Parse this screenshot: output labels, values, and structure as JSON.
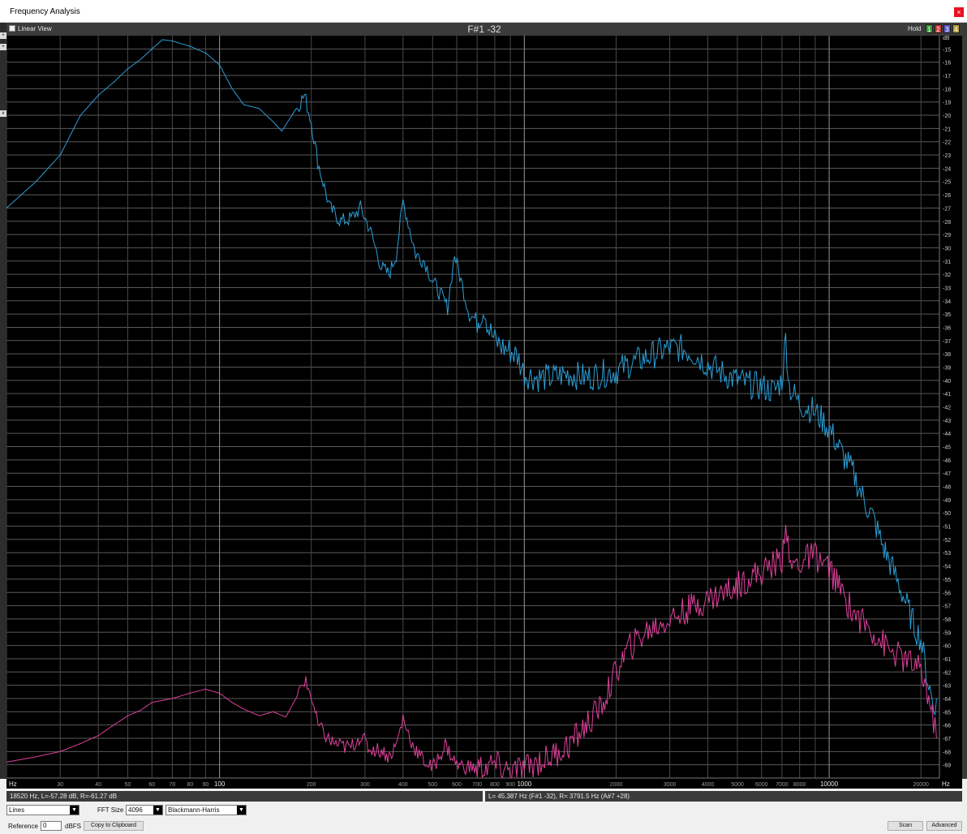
{
  "window": {
    "title": "Frequency Analysis",
    "close_glyph": "×"
  },
  "left_strip": {
    "marks": [
      "+",
      "+",
      "v"
    ]
  },
  "header": {
    "linear_view_label": "Linear View",
    "plot_title": "F#1 -32",
    "hold_label": "Hold",
    "hold_buttons": [
      {
        "label": "1",
        "color": "#3c9c3c"
      },
      {
        "label": "2",
        "color": "#c83c3c"
      },
      {
        "label": "3",
        "color": "#5a5ac8"
      },
      {
        "label": "4",
        "color": "#b4a03c"
      }
    ]
  },
  "chart_data": {
    "type": "line",
    "title": "F#1 -32",
    "x_scale": "log",
    "xlim": [
      20,
      23000
    ],
    "ylim": [
      -70,
      -14
    ],
    "y_unit": "dB",
    "x_unit": "Hz",
    "grid": true,
    "x_tick_labels": [
      {
        "f": 30,
        "label": "30"
      },
      {
        "f": 40,
        "label": "40"
      },
      {
        "f": 50,
        "label": "50"
      },
      {
        "f": 60,
        "label": "60"
      },
      {
        "f": 70,
        "label": "70"
      },
      {
        "f": 80,
        "label": "80"
      },
      {
        "f": 90,
        "label": "90"
      },
      {
        "f": 100,
        "label": "100"
      },
      {
        "f": 200,
        "label": "200"
      },
      {
        "f": 300,
        "label": "300"
      },
      {
        "f": 400,
        "label": "400"
      },
      {
        "f": 500,
        "label": "500"
      },
      {
        "f": 600,
        "label": "600"
      },
      {
        "f": 700,
        "label": "700"
      },
      {
        "f": 800,
        "label": "800"
      },
      {
        "f": 900,
        "label": "900"
      },
      {
        "f": 1000,
        "label": "1000"
      },
      {
        "f": 2000,
        "label": "2000"
      },
      {
        "f": 3000,
        "label": "3000"
      },
      {
        "f": 4000,
        "label": "4000"
      },
      {
        "f": 5000,
        "label": "5000"
      },
      {
        "f": 6000,
        "label": "6000"
      },
      {
        "f": 7000,
        "label": "7000"
      },
      {
        "f": 8000,
        "label": "8000"
      },
      {
        "f": 10000,
        "label": "10000"
      },
      {
        "f": 20000,
        "label": "20000"
      }
    ],
    "y_ticks": [
      -15,
      -16,
      -17,
      -18,
      -19,
      -20,
      -21,
      -22,
      -23,
      -24,
      -25,
      -26,
      -27,
      -28,
      -29,
      -30,
      -31,
      -32,
      -33,
      -34,
      -35,
      -36,
      -37,
      -38,
      -39,
      -40,
      -41,
      -42,
      -43,
      -44,
      -45,
      -46,
      -47,
      -48,
      -49,
      -50,
      -51,
      -52,
      -53,
      -54,
      -55,
      -56,
      -57,
      -58,
      -59,
      -60,
      -61,
      -62,
      -63,
      -64,
      -65,
      -66,
      -67,
      -68,
      -69
    ],
    "series": [
      {
        "channel": "L",
        "color": "#2b9fd8",
        "points": [
          [
            20,
            -27.0
          ],
          [
            25,
            -25.0
          ],
          [
            30,
            -23.0
          ],
          [
            35,
            -20.0
          ],
          [
            40,
            -18.5
          ],
          [
            45,
            -17.5
          ],
          [
            50,
            -16.5
          ],
          [
            55,
            -15.8
          ],
          [
            60,
            -15.0
          ],
          [
            65,
            -14.3
          ],
          [
            70,
            -14.4
          ],
          [
            80,
            -14.8
          ],
          [
            90,
            -15.3
          ],
          [
            100,
            -16.2
          ],
          [
            110,
            -18.0
          ],
          [
            120,
            -19.2
          ],
          [
            135,
            -19.5
          ],
          [
            150,
            -20.5
          ],
          [
            160,
            -21.2
          ],
          [
            175,
            -19.8
          ],
          [
            190,
            -18.5
          ],
          [
            200,
            -20.5
          ],
          [
            210,
            -23.5
          ],
          [
            230,
            -27.0
          ],
          [
            250,
            -28.0
          ],
          [
            270,
            -27.8
          ],
          [
            290,
            -27.0
          ],
          [
            310,
            -28.5
          ],
          [
            340,
            -31.5
          ],
          [
            360,
            -32.0
          ],
          [
            380,
            -30.5
          ],
          [
            400,
            -26.5
          ],
          [
            420,
            -28.5
          ],
          [
            440,
            -30.5
          ],
          [
            470,
            -31.0
          ],
          [
            500,
            -32.5
          ],
          [
            530,
            -33.5
          ],
          [
            560,
            -34.5
          ],
          [
            590,
            -30.5
          ],
          [
            620,
            -32.5
          ],
          [
            660,
            -35.0
          ],
          [
            700,
            -35.5
          ],
          [
            740,
            -34.5
          ],
          [
            760,
            -36.0
          ],
          [
            800,
            -37.0
          ],
          [
            850,
            -37.5
          ],
          [
            900,
            -37.8
          ],
          [
            950,
            -38.2
          ],
          [
            1000,
            -39.5
          ],
          [
            1100,
            -39.8
          ],
          [
            1200,
            -39.8
          ],
          [
            1400,
            -39.5
          ],
          [
            1600,
            -39.8
          ],
          [
            1800,
            -39.5
          ],
          [
            2000,
            -39.3
          ],
          [
            2200,
            -38.8
          ],
          [
            2500,
            -38.3
          ],
          [
            2800,
            -37.8
          ],
          [
            3000,
            -37.6
          ],
          [
            3300,
            -37.6
          ],
          [
            3600,
            -38.0
          ],
          [
            4000,
            -38.8
          ],
          [
            4500,
            -39.5
          ],
          [
            5000,
            -40.0
          ],
          [
            5500,
            -40.3
          ],
          [
            6000,
            -40.5
          ],
          [
            6600,
            -40.8
          ],
          [
            7000,
            -40.0
          ],
          [
            7200,
            -36.8
          ],
          [
            7400,
            -40.5
          ],
          [
            8000,
            -41.8
          ],
          [
            8800,
            -42.2
          ],
          [
            9500,
            -43.0
          ],
          [
            10000,
            -43.6
          ],
          [
            11000,
            -45.5
          ],
          [
            12000,
            -47.0
          ],
          [
            13000,
            -49.0
          ],
          [
            14000,
            -50.5
          ],
          [
            15000,
            -52.5
          ],
          [
            16000,
            -54.0
          ],
          [
            17000,
            -55.5
          ],
          [
            18000,
            -57.0
          ],
          [
            19000,
            -58.5
          ],
          [
            20000,
            -59.5
          ],
          [
            21000,
            -62.5
          ],
          [
            22000,
            -64.5
          ],
          [
            22500,
            -64.0
          ]
        ]
      },
      {
        "channel": "R",
        "color": "#e0409c",
        "points": [
          [
            20,
            -68.8
          ],
          [
            25,
            -68.4
          ],
          [
            30,
            -68.0
          ],
          [
            35,
            -67.4
          ],
          [
            40,
            -66.8
          ],
          [
            45,
            -66.0
          ],
          [
            50,
            -65.3
          ],
          [
            55,
            -64.9
          ],
          [
            60,
            -64.3
          ],
          [
            70,
            -64.0
          ],
          [
            80,
            -63.6
          ],
          [
            90,
            -63.3
          ],
          [
            100,
            -63.6
          ],
          [
            110,
            -64.3
          ],
          [
            120,
            -64.8
          ],
          [
            135,
            -65.3
          ],
          [
            150,
            -65.0
          ],
          [
            165,
            -65.4
          ],
          [
            180,
            -63.8
          ],
          [
            190,
            -62.6
          ],
          [
            200,
            -63.8
          ],
          [
            210,
            -66.0
          ],
          [
            230,
            -67.2
          ],
          [
            250,
            -67.6
          ],
          [
            270,
            -67.7
          ],
          [
            290,
            -66.8
          ],
          [
            310,
            -67.8
          ],
          [
            340,
            -67.9
          ],
          [
            360,
            -68.4
          ],
          [
            380,
            -67.5
          ],
          [
            400,
            -65.5
          ],
          [
            430,
            -67.5
          ],
          [
            460,
            -68.5
          ],
          [
            500,
            -69.3
          ],
          [
            550,
            -67.5
          ],
          [
            600,
            -69.0
          ],
          [
            700,
            -69.3
          ],
          [
            800,
            -69.0
          ],
          [
            900,
            -69.5
          ],
          [
            1000,
            -69.3
          ],
          [
            1100,
            -68.8
          ],
          [
            1200,
            -68.5
          ],
          [
            1400,
            -67.5
          ],
          [
            1600,
            -66.0
          ],
          [
            1800,
            -64.5
          ],
          [
            2000,
            -62.0
          ],
          [
            2200,
            -60.2
          ],
          [
            2500,
            -59.0
          ],
          [
            2800,
            -58.3
          ],
          [
            3000,
            -58.0
          ],
          [
            3300,
            -57.5
          ],
          [
            3600,
            -57.0
          ],
          [
            4000,
            -56.5
          ],
          [
            4500,
            -56.0
          ],
          [
            5000,
            -55.5
          ],
          [
            5500,
            -54.8
          ],
          [
            6000,
            -54.5
          ],
          [
            6600,
            -53.8
          ],
          [
            7000,
            -53.5
          ],
          [
            7200,
            -50.3
          ],
          [
            7400,
            -54.0
          ],
          [
            8000,
            -53.8
          ],
          [
            8500,
            -53.4
          ],
          [
            9000,
            -53.2
          ],
          [
            9500,
            -53.8
          ],
          [
            10000,
            -54.2
          ],
          [
            11000,
            -56.0
          ],
          [
            12000,
            -57.5
          ],
          [
            13000,
            -58.3
          ],
          [
            14000,
            -59.0
          ],
          [
            15000,
            -59.8
          ],
          [
            16000,
            -60.5
          ],
          [
            17000,
            -60.8
          ],
          [
            18000,
            -61.2
          ],
          [
            19000,
            -61.5
          ],
          [
            20000,
            -62.0
          ],
          [
            21000,
            -63.5
          ],
          [
            22000,
            -65.8
          ],
          [
            22500,
            -67.0
          ]
        ]
      }
    ]
  },
  "status": {
    "left": "18520 Hz, L=-57.28 dB, R=-61.27 dB",
    "right": "L= 45.387 Hz (F#1 -32), R= 3791.5 Hz (A#7 +28)"
  },
  "controls": {
    "mode_select": "Lines",
    "fft_label": "FFT Size",
    "fft_value": "4096",
    "window_select": "Blackmann-Harris",
    "reference_label": "Reference",
    "reference_value": "0",
    "dbfs_label": "dBFS",
    "copy_button": "Copy to Clipboard",
    "scan_button": "Scan",
    "advanced_button": "Advanced"
  }
}
